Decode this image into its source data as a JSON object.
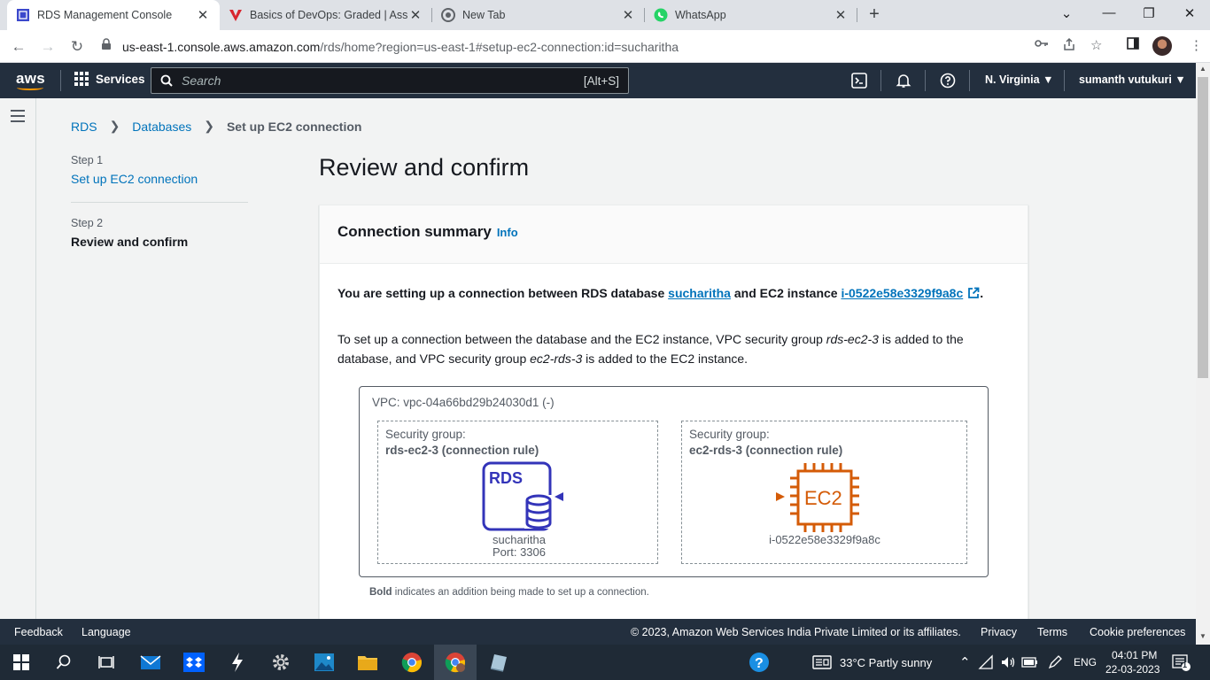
{
  "browser": {
    "tabs": [
      {
        "title": "RDS Management Console",
        "icon": "aws-rds-favicon"
      },
      {
        "title": "Basics of DevOps: Graded | Asse",
        "icon": "v-logo-favicon"
      },
      {
        "title": "New Tab",
        "icon": "chrome-favicon"
      },
      {
        "title": "WhatsApp",
        "icon": "whatsapp-favicon"
      }
    ],
    "url_host": "us-east-1.console.aws.amazon.com",
    "url_path": "/rds/home?region=us-east-1#setup-ec2-connection:id=sucharitha"
  },
  "aws_nav": {
    "services_label": "Services",
    "search_placeholder": "Search",
    "search_shortcut": "[Alt+S]",
    "region": "N. Virginia",
    "user": "sumanth vutukuri"
  },
  "breadcrumb": [
    "RDS",
    "Databases",
    "Set up EC2 connection"
  ],
  "steps": [
    {
      "num": "Step 1",
      "label": "Set up EC2 connection"
    },
    {
      "num": "Step 2",
      "label": "Review and confirm"
    }
  ],
  "page_title": "Review and confirm",
  "panel": {
    "title": "Connection summary",
    "info": "Info",
    "p1_a": "You are setting up a connection between RDS database ",
    "p1_db": "sucharitha",
    "p1_b": " and EC2 instance ",
    "p1_ec2": "i-0522e58e3329f9a8c",
    "p1_c": ".",
    "p2_a": "To set up a connection between the database and the EC2 instance, VPC security group ",
    "p2_sg1": "rds-ec2-3",
    "p2_b": " is added to the database, and VPC security group ",
    "p2_sg2": "ec2-rds-3",
    "p2_c": " is added to the EC2 instance."
  },
  "diagram": {
    "vpc": "VPC: vpc-04a66bd29b24030d1 (-)",
    "sg_left_prefix": "Security group:",
    "sg_left_name": "rds-ec2-3 (connection rule)",
    "sg_right_prefix": "Security group:",
    "sg_right_name": "ec2-rds-3 (connection rule)",
    "rds_icon_text": "RDS",
    "ec2_icon_text": "EC2",
    "db_name": "sucharitha",
    "db_port": "Port: 3306",
    "ec2_id": "i-0522e58e3329f9a8c",
    "legend_bold": "Bold",
    "legend_rest": " indicates an addition being made to set up a connection.",
    "colors": {
      "rds": "#3334b9",
      "ec2": "#d45b07"
    }
  },
  "footer": {
    "feedback": "Feedback",
    "language": "Language",
    "copyright": "© 2023, Amazon Web Services India Private Limited or its affiliates.",
    "privacy": "Privacy",
    "terms": "Terms",
    "cookies": "Cookie preferences"
  },
  "taskbar": {
    "weather": "33°C  Partly sunny",
    "lang": "ENG",
    "time": "04:01 PM",
    "date": "22-03-2023",
    "notifications": "1"
  }
}
